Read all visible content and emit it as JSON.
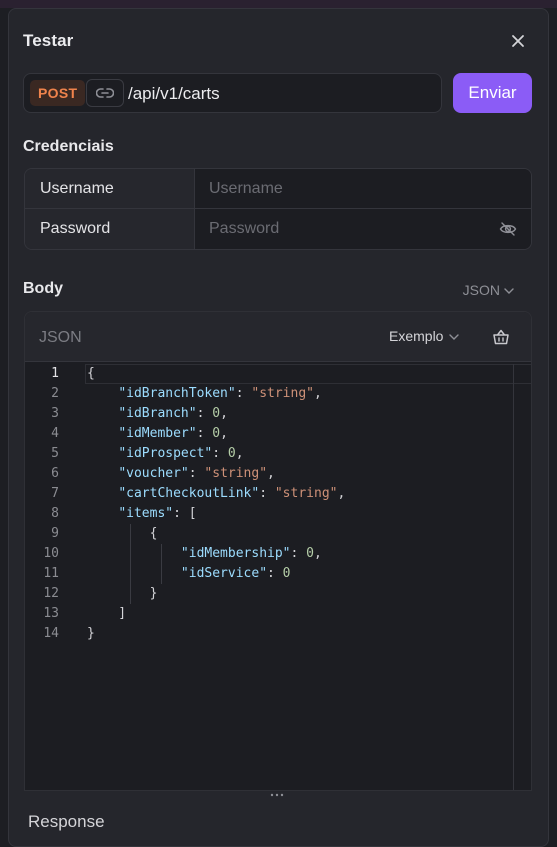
{
  "dialog": {
    "title": "Testar"
  },
  "request": {
    "method": "POST",
    "path": "/api/v1/carts",
    "send_label": "Enviar",
    "method_color": "#f0834c",
    "accent_color": "#8b5cf6"
  },
  "credentials": {
    "heading": "Credenciais",
    "username_label": "Username",
    "username_placeholder": "Username",
    "password_label": "Password",
    "password_placeholder": "Password"
  },
  "body": {
    "heading": "Body",
    "format_selected": "JSON",
    "editor_label": "JSON",
    "example_label": "Exemplo",
    "line_numbers": [
      "1",
      "2",
      "3",
      "4",
      "5",
      "6",
      "7",
      "8",
      "9",
      "10",
      "11",
      "12",
      "13",
      "14"
    ],
    "lines": [
      "{",
      "    \"idBranchToken\": \"string\",",
      "    \"idBranch\": 0,",
      "    \"idMember\": 0,",
      "    \"idProspect\": 0,",
      "    \"voucher\": \"string\",",
      "    \"cartCheckoutLink\": \"string\",",
      "    \"items\": [",
      "        {",
      "            \"idMembership\": 0,",
      "            \"idService\": 0",
      "        }",
      "    ]",
      "}"
    ]
  },
  "response": {
    "label": "Response"
  },
  "icons": [
    "close-icon",
    "link-icon",
    "eye-off-icon",
    "chevron-down-icon",
    "basket-clear-icon",
    "drag-handle-icon"
  ]
}
